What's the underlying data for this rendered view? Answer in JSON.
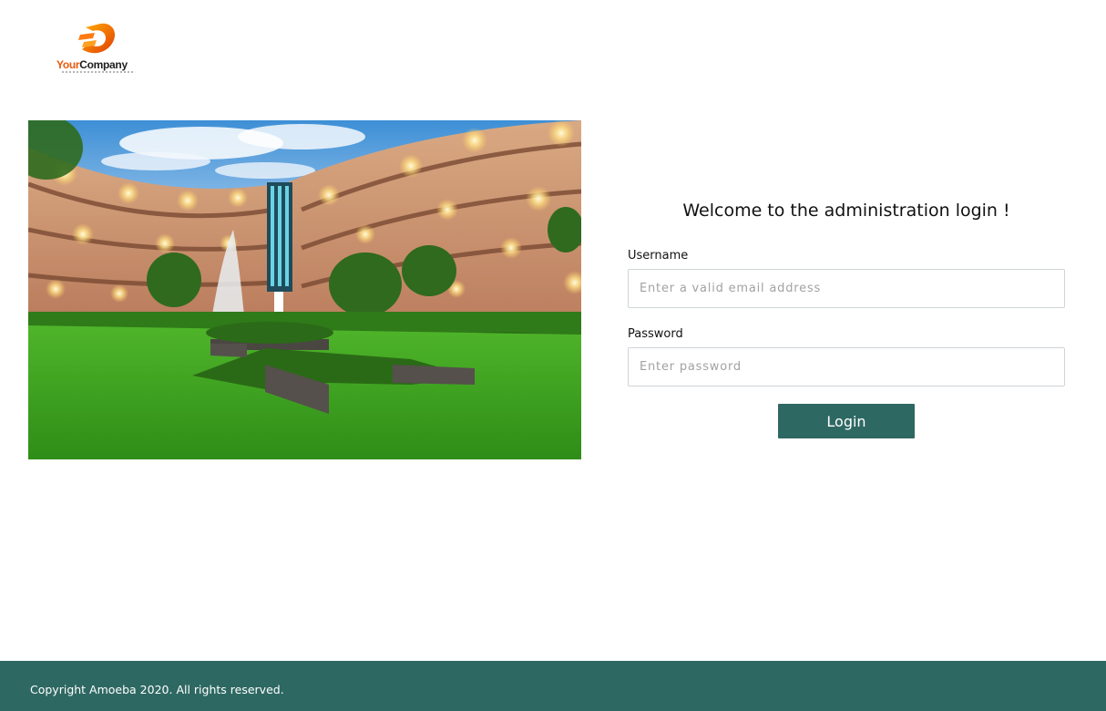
{
  "logo": {
    "name_part1": "Your",
    "name_part2": "Company",
    "brand_color": "#e85a0c",
    "icon": "company-logo-icon"
  },
  "hero": {
    "icon": "building-courtyard-photo"
  },
  "login": {
    "welcome_title": "Welcome to the administration login !",
    "username_label": "Username",
    "username_placeholder": "Enter a valid email address",
    "username_value": "",
    "password_label": "Password",
    "password_placeholder": "Enter password",
    "password_value": "",
    "login_button": "Login"
  },
  "footer": {
    "copyright": "Copyright Amoeba 2020. All rights reserved."
  },
  "colors": {
    "accent": "#2e6862",
    "background": "#ffffff",
    "input_border": "#cfd4d8"
  }
}
